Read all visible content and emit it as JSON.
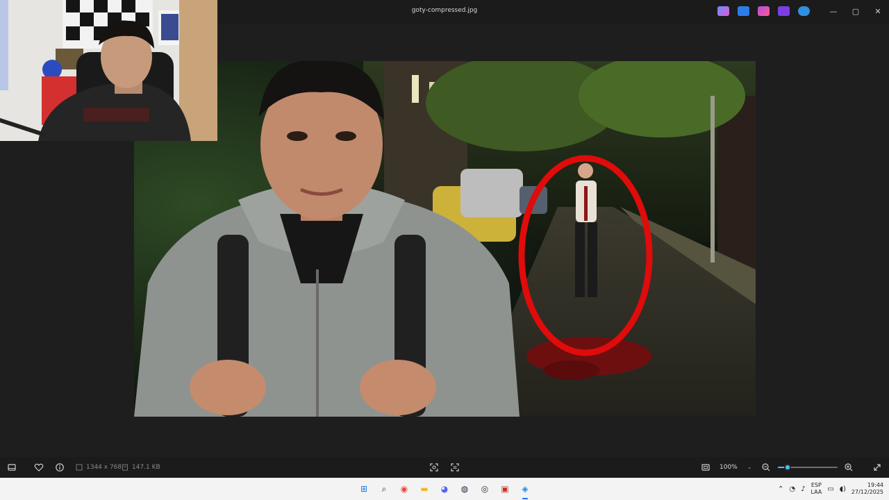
{
  "window": {
    "title": "goty-compressed.jpg",
    "controls": {
      "minimize": "—",
      "maximize": "▢",
      "close": "✕"
    },
    "app_icons": [
      {
        "name": "copilot-icon",
        "color": "#6f8bff"
      },
      {
        "name": "photos-edit-icon",
        "color": "#2b7de9"
      },
      {
        "name": "designer-icon",
        "color": "#b04ce6"
      },
      {
        "name": "clipchamp-icon",
        "color": "#7b3fe4"
      },
      {
        "name": "onedrive-icon",
        "color": "#2f8fe0"
      }
    ]
  },
  "toolbar": {
    "dimensions": "1344 x 768",
    "file_size": "147.1 KB",
    "zoom_level": "100%",
    "zoom_fraction": 0.16
  },
  "taskbar": {
    "apps": [
      {
        "name": "start-icon",
        "glyph": "⊞",
        "color": "#1a73e8"
      },
      {
        "name": "search-icon",
        "glyph": "⌕",
        "color": "#222"
      },
      {
        "name": "chrome-icon",
        "glyph": "◉",
        "color": "#e8453c"
      },
      {
        "name": "file-explorer-icon",
        "glyph": "▬",
        "color": "#f2b825"
      },
      {
        "name": "discord-icon",
        "glyph": "◕",
        "color": "#5865f2"
      },
      {
        "name": "steam-icon",
        "glyph": "◍",
        "color": "#1b2838"
      },
      {
        "name": "obs-icon",
        "glyph": "◎",
        "color": "#302e31"
      },
      {
        "name": "game-app-icon",
        "glyph": "▣",
        "color": "#c0392b"
      },
      {
        "name": "photos-icon",
        "glyph": "◈",
        "color": "#1e88e5"
      }
    ],
    "language": "ESP",
    "layout": "LAA",
    "time": "19:44",
    "date": "27/12/2025"
  }
}
